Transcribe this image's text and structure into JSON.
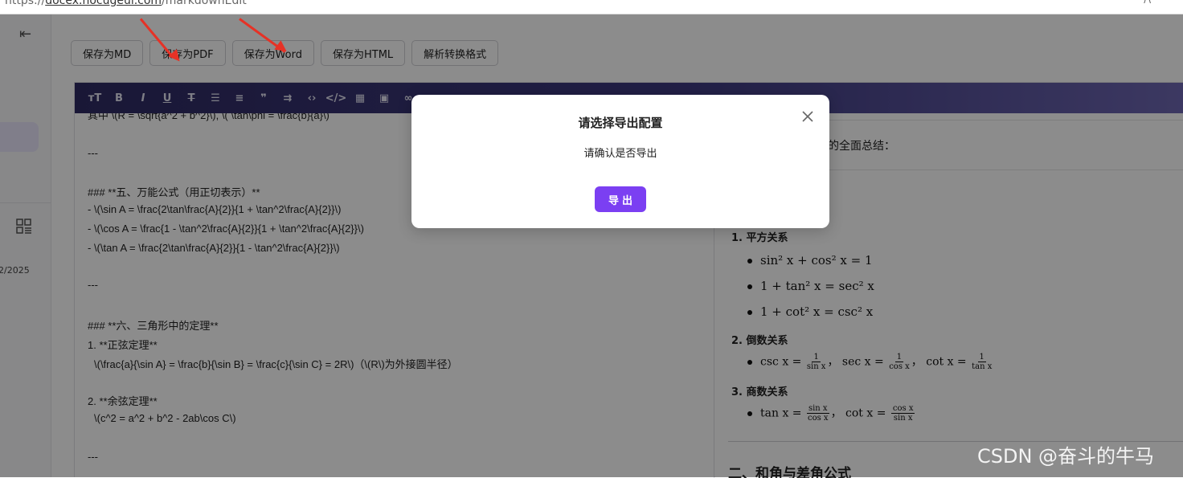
{
  "browser": {
    "url_prefix": "https://",
    "url_host": "docex.nocugeui.com",
    "url_path": "/markdownEdit",
    "corner": "/\\"
  },
  "sidebar": {
    "date": "2/2025"
  },
  "toolbar": {
    "buttons": [
      "保存为MD",
      "保存为PDF",
      "保存为Word",
      "保存为HTML",
      "解析转换格式"
    ]
  },
  "md_toolbar_icons": [
    "heading-icon",
    "bold-icon",
    "italic-icon",
    "underline-icon",
    "strikethrough-icon",
    "bullet-list-icon",
    "ordered-list-icon",
    "quote-icon",
    "wrap-icon",
    "code-icon",
    "code-block-icon",
    "table-icon",
    "image-icon",
    "link-icon"
  ],
  "source": {
    "lines": [
      "其中 \\(R = \\sqrt{a^2 + b^2}\\), \\( \\tan\\phi = \\frac{b}{a}\\)",
      "---",
      "### **五、万能公式（用正切表示）**",
      "- \\(\\sin A = \\frac{2\\tan\\frac{A}{2}}{1 + \\tan^2\\frac{A}{2}}\\)",
      "- \\(\\cos A = \\frac{1 - \\tan^2\\frac{A}{2}}{1 + \\tan^2\\frac{A}{2}}\\)",
      "- \\(\\tan A = \\frac{2\\tan\\frac{A}{2}}{1 - \\tan^2\\frac{A}{2}}\\)",
      "---",
      "### **六、三角形中的定理**",
      "1. **正弦定理**",
      "\\(\\frac{a}{\\sin A} = \\frac{b}{\\sin B} = \\frac{c}{\\sin C} = 2R\\)（\\(R\\)为外接圆半径）",
      "2. **余弦定理**",
      "\\(c^2 = a^2 + b^2 - 2ab\\cos C\\)",
      "---"
    ]
  },
  "preview": {
    "intro": "的全面总结：",
    "h_square": "1. 平方关系",
    "sq1": "sin² x + cos² x = 1",
    "sq2": "1 + tan² x = sec² x",
    "sq3": "1 + cot² x = csc² x",
    "h_recip": "2. 倒数关系",
    "recip_csc": "csc x =",
    "recip_sec": "sec x =",
    "recip_cot": "cot x =",
    "recip_csc_den": "sin x",
    "recip_sec_den": "cos x",
    "recip_cot_den": "tan x",
    "one": "1",
    "h_quot": "3. 商数关系",
    "quot_tan": "tan x =",
    "quot_cot": "cot x =",
    "sin_x": "sin x",
    "cos_x": "cos x",
    "comma": "，",
    "h2": "二、和角与差角公式"
  },
  "modal": {
    "title": "请选择导出配置",
    "message": "请确认是否导出",
    "button": "导出"
  },
  "watermark": "CSDN @奋斗的牛马"
}
